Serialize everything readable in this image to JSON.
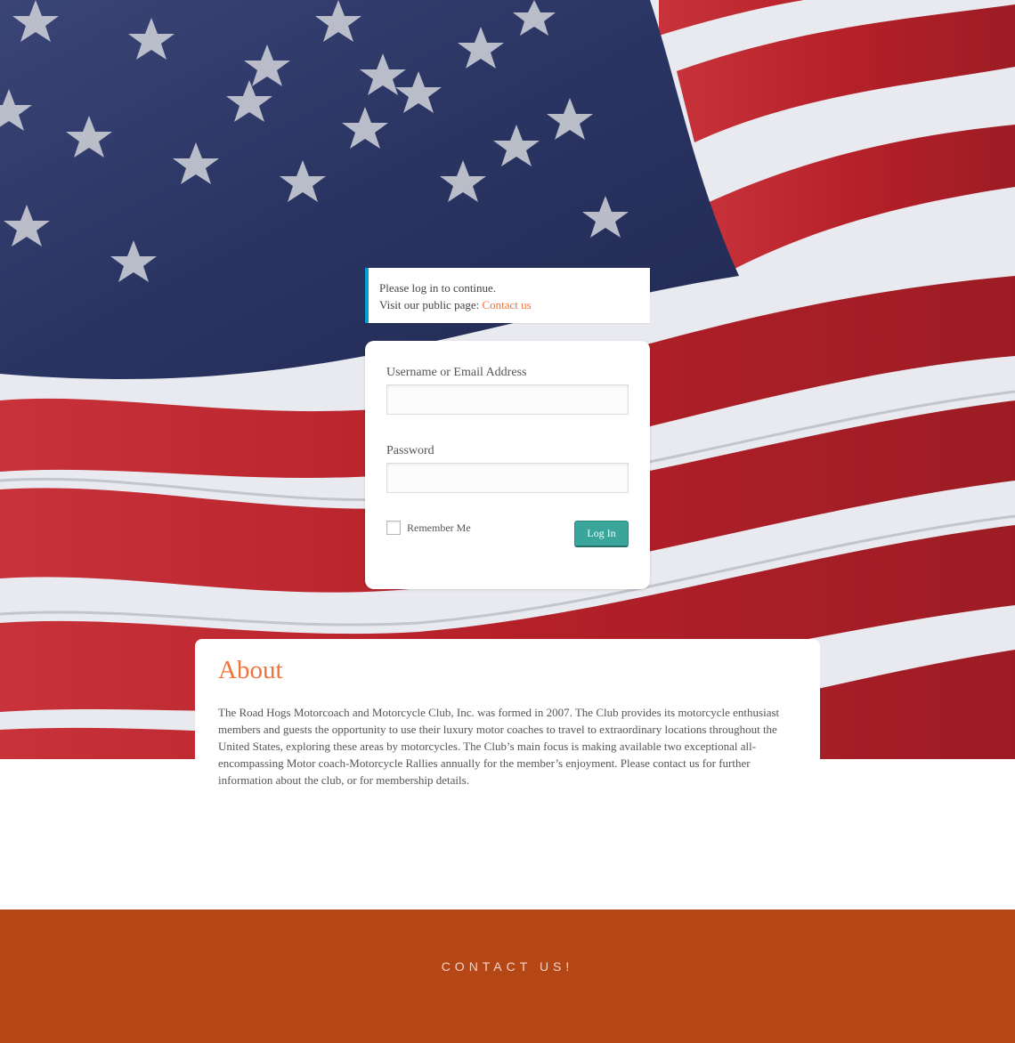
{
  "notice": {
    "line1": "Please log in to continue.",
    "line2_prefix": "Visit our public page: ",
    "link": "Contact us"
  },
  "login": {
    "username_label": "Username or Email Address",
    "username_value": "",
    "password_label": "Password",
    "password_value": "",
    "remember_label": "Remember Me",
    "remember_checked": false,
    "submit_label": "Log In"
  },
  "about": {
    "title": "About",
    "body": "The Road Hogs Motorcoach and Motorcycle Club, Inc. was formed in 2007. The Club provides its motorcycle enthusiast members and guests the opportunity to use their luxury motor coaches to travel to extraordinary locations throughout the United States, exploring these areas by motorcycles. The Club’s main focus is making available two exceptional all-encompassing Motor coach-Motorcycle Rallies annually for the member’s enjoyment. Please contact us for further information about the club, or for membership details."
  },
  "footer": {
    "title": "CONTACT US!"
  },
  "colors": {
    "accent": "#f2733a",
    "notice_border": "#00a0d2",
    "button": "#3aa59a",
    "footer": "#b54616",
    "flag_blue": "#2b3566",
    "flag_red": "#b3222b"
  }
}
